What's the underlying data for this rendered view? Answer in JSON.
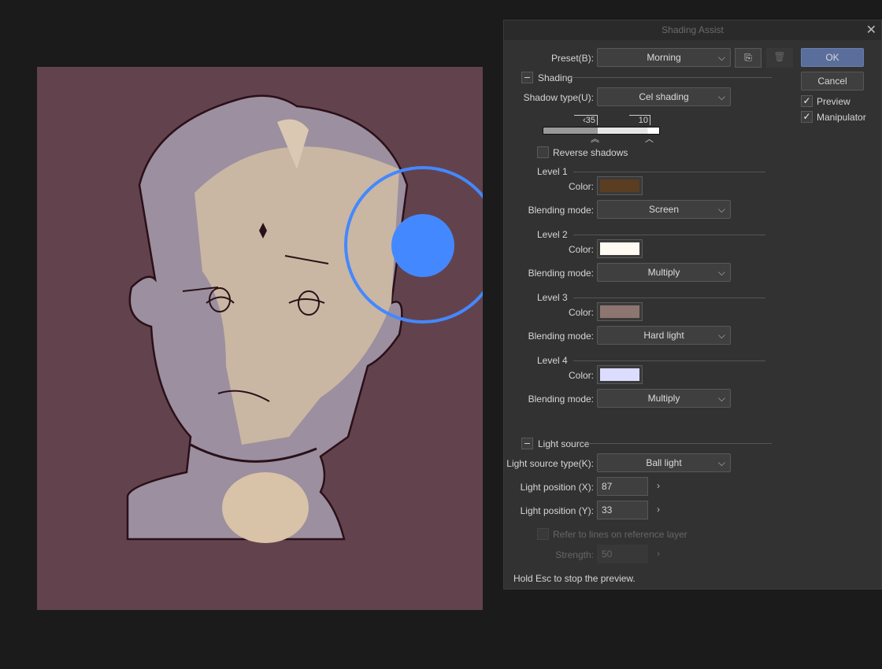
{
  "dialog": {
    "title": "Shading Assist",
    "close": "✕",
    "preset_label": "Preset(B):",
    "preset_value": "Morning",
    "ok": "OK",
    "cancel": "Cancel",
    "preview": "Preview",
    "manipulator": "Manipulator",
    "shading_section": "Shading",
    "shadow_type_label": "Shadow type(U):",
    "shadow_type_value": "Cel shading",
    "slider": {
      "value_a": "‹35",
      "value_b": "10",
      "position_a": 0.47,
      "position_b": 0.9
    },
    "reverse_shadows": "Reverse shadows",
    "levels": [
      {
        "title": "Level 1",
        "color_label": "Color:",
        "color": "#5b3d22",
        "blend_label": "Blending mode:",
        "blend": "Screen"
      },
      {
        "title": "Level 2",
        "color_label": "Color:",
        "color": "#fffaf2",
        "blend_label": "Blending mode:",
        "blend": "Multiply"
      },
      {
        "title": "Level 3",
        "color_label": "Color:",
        "color": "#8d7670",
        "blend_label": "Blending mode:",
        "blend": "Hard light"
      },
      {
        "title": "Level 4",
        "color_label": "Color:",
        "color": "#dcdcff",
        "blend_label": "Blending mode:",
        "blend": "Multiply"
      }
    ],
    "light_section": "Light source",
    "light_type_label": "Light source type(K):",
    "light_type_value": "Ball light",
    "pos_x_label": "Light position (X):",
    "pos_x": "87",
    "pos_y_label": "Light position (Y):",
    "pos_y": "33",
    "refer_lines": "Refer to lines on reference layer",
    "strength_label": "Strength:",
    "strength": "50",
    "footer": "Hold Esc to stop the preview."
  },
  "colors": {
    "accent": "#5a6e9c",
    "manipulator": "#4488ff",
    "canvas": "#62434d"
  }
}
